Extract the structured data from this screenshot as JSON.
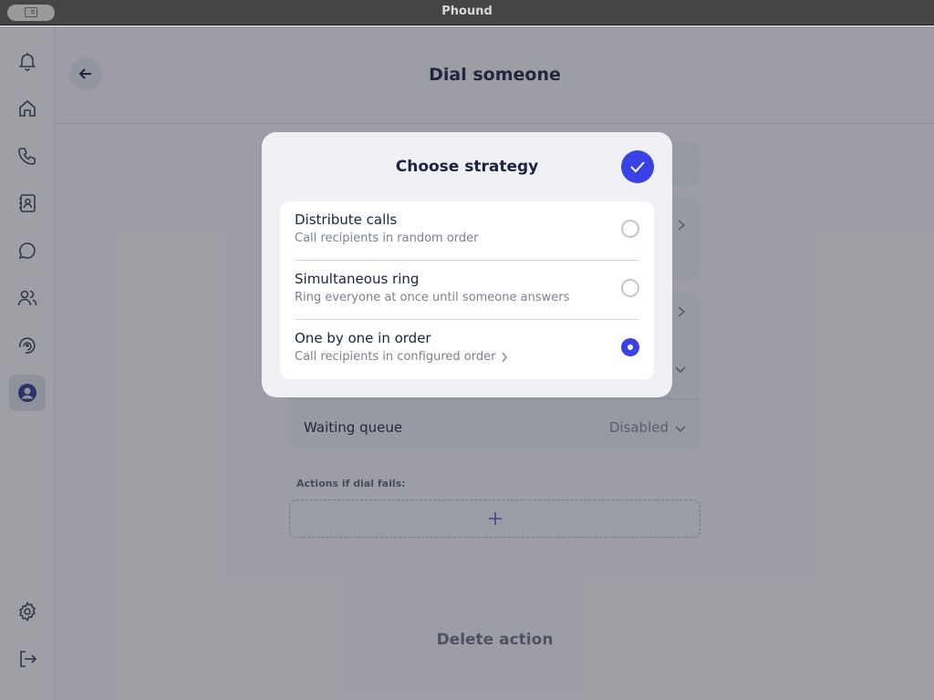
{
  "window": {
    "title": "Phound"
  },
  "sidebar": {
    "items": [
      {
        "icon": "bell-icon"
      },
      {
        "icon": "home-icon"
      },
      {
        "icon": "phone-icon"
      },
      {
        "icon": "contacts-icon"
      },
      {
        "icon": "chat-icon"
      },
      {
        "icon": "users-icon"
      },
      {
        "icon": "integrations-icon"
      },
      {
        "icon": "profile-icon",
        "active": true
      }
    ],
    "bottom": [
      {
        "icon": "settings-icon"
      },
      {
        "icon": "logout-icon"
      }
    ]
  },
  "page": {
    "title": "Dial someone",
    "waiting_queue": {
      "label": "Waiting queue",
      "value": "Disabled"
    },
    "actions_label": "Actions if dial fails:",
    "delete_action": "Delete action"
  },
  "modal": {
    "title": "Choose strategy",
    "options": [
      {
        "title": "Distribute calls",
        "subtitle": "Call recipients in random order",
        "selected": false
      },
      {
        "title": "Simultaneous ring",
        "subtitle": "Ring everyone at once until someone answers",
        "selected": false
      },
      {
        "title": "One by one in order",
        "subtitle": "Call recipients in configured order",
        "selected": true
      }
    ]
  },
  "colors": {
    "accent": "#3a42e6",
    "text": "#1c2340",
    "muted": "#7b8092"
  }
}
